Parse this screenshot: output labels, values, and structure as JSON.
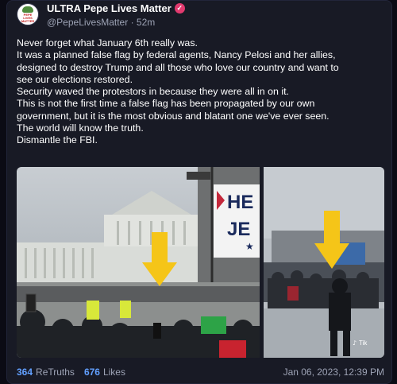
{
  "post": {
    "author": {
      "display_name": "ULTRA Pepe Lives Matter",
      "handle": "@PepeLivesMatter",
      "time_ago": "52m",
      "avatar_text": [
        "PEPE",
        "LIVES",
        "MATTER"
      ]
    },
    "text_lines": [
      "Never forget what January 6th really was.",
      "It was a planned false flag by federal agents, Nancy Pelosi and her allies,",
      "designed to destroy Trump and all those who love our country and want to",
      "see our elections restored.",
      "Security waved the protestors in because they were all in on it.",
      "This is not the first time a false flag has been propagated by our own",
      "government, but it is the most obvious and blatant one we've ever seen.",
      "The world will know the truth.",
      "Dismantle the FBI."
    ],
    "media": {
      "left_sign_text_1": "HE",
      "left_sign_text_2": "JE",
      "watermark": "Tik"
    },
    "stats": {
      "retruths_count": "364",
      "retruths_label": "ReTruths",
      "likes_count": "676",
      "likes_label": "Likes"
    },
    "timestamp": "Jan 06, 2023, 12:39 PM"
  },
  "colors": {
    "background": "#0b0b14",
    "card": "#181a25",
    "accent_link": "#62a0ff",
    "verified_badge": "#e23a6f",
    "arrow_yellow": "#f5c518"
  }
}
